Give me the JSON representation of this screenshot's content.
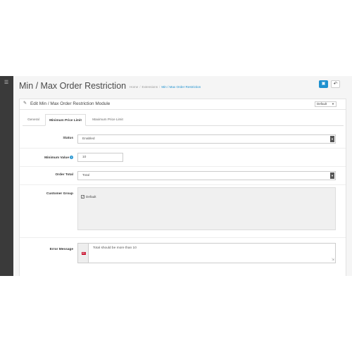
{
  "sidebar": {
    "toggle_icon": "menu-icon"
  },
  "header": {
    "title": "Min / Max Order Restriction",
    "breadcrumb": [
      "Home",
      "Extensions",
      "Min / Max Order Restriction"
    ],
    "save_icon": "save-icon",
    "back_icon": "reply-icon"
  },
  "panel": {
    "title": "Edit Min / Max Order Restriction Module",
    "store_select": "Default"
  },
  "tabs": [
    {
      "label": "General"
    },
    {
      "label": "Minimum Price Limit",
      "active": true
    },
    {
      "label": "Maximum Price Limit"
    }
  ],
  "form": {
    "status": {
      "label": "Status",
      "value": "Enabled"
    },
    "minimum_value": {
      "label": "Minimum Value",
      "value": "10"
    },
    "order_total": {
      "label": "Order Total",
      "value": "Total"
    },
    "customer_group": {
      "label": "Customer Group",
      "options": [
        {
          "label": "Default",
          "checked": true
        }
      ]
    },
    "error_message": {
      "label": "Error Message",
      "value": "Total should be more than 10"
    }
  },
  "colors": {
    "accent": "#1e91cf",
    "sidebar": "#3a3a3a",
    "background": "#f5f5f5"
  }
}
